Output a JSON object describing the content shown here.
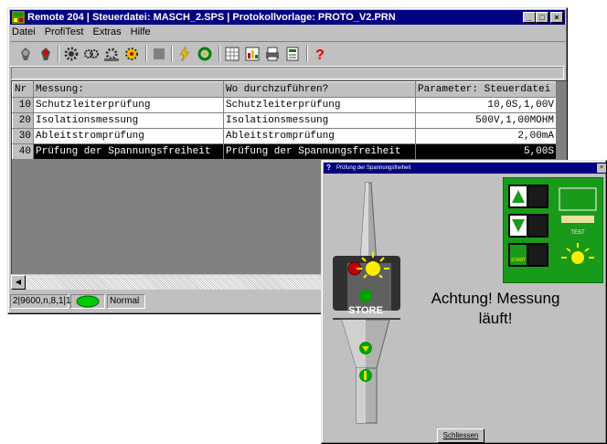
{
  "window": {
    "title": "Remote 204 | Steuerdatei: MASCH_2.SPS | Protokollvorlage: PROTO_V2.PRN",
    "buttons": [
      "_",
      "□",
      "×"
    ]
  },
  "menu": [
    "Datei",
    "ProfiTest",
    "Extras",
    "Hilfe"
  ],
  "table": {
    "headers": [
      "Nr",
      "Messung:",
      "Wo durchzuführen?",
      "Parameter: Steuerdatei"
    ],
    "rows": [
      {
        "nr": "10",
        "messung": "Schutzleiterprüfung",
        "wo": "Schutzleiterprüfung",
        "param": "10,0S,1,00V"
      },
      {
        "nr": "20",
        "messung": "Isolationsmessung",
        "wo": "Isolationsmessung",
        "param": "500V,1,00MOHM"
      },
      {
        "nr": "30",
        "messung": "Ableitstromprüfung",
        "wo": "Ableitstromprüfung",
        "param": "2,00mA"
      },
      {
        "nr": "40",
        "messung": "Prüfung der Spannungsfreiheit",
        "wo": "Prüfung der Spannungsfreiheit",
        "param": "5,00S"
      }
    ],
    "selected_row": 3
  },
  "status": {
    "port": "2|9600,n,8,1|1",
    "mode": "Normal",
    "led_color": "#00cc00"
  },
  "dialog": {
    "title": "Prüfung der Spannungsfreiheit",
    "icon": "?",
    "close": "×",
    "probe_label": "STORE",
    "message_line1": "Achtung! Messung",
    "message_line2": "läuft!",
    "close_button": "Schliessen",
    "panel_start": "START",
    "panel_test": "TEST"
  },
  "colors": {
    "titlebar": "#000080",
    "panel_green": "#1a9a1a",
    "selection": "#000000"
  }
}
